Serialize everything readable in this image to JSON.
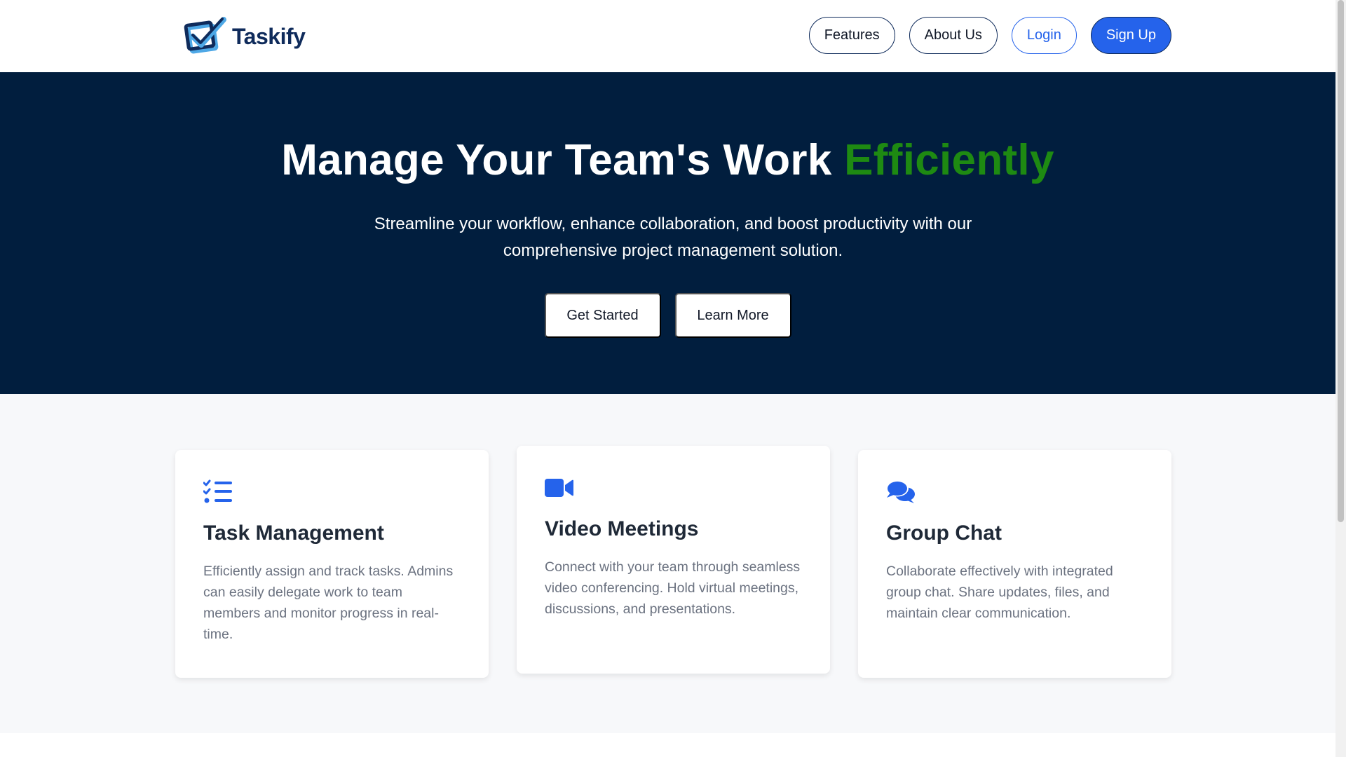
{
  "brand": {
    "name": "Taskify",
    "logo_icon": "checkbox-check-logo",
    "color_dark": "#0f2b5b",
    "color_accent": "#2563eb"
  },
  "nav": {
    "features": "Features",
    "about": "About Us",
    "login": "Login",
    "signup": "Sign Up"
  },
  "hero": {
    "title_main": "Manage Your Team's Work ",
    "title_accent": "Efficiently",
    "subtitle": "Streamline your workflow, enhance collaboration, and boost productivity with our comprehensive project management solution.",
    "get_started": "Get Started",
    "learn_more": "Learn More",
    "background_color": "#011e3e",
    "accent_color": "#1e8a12"
  },
  "features": [
    {
      "icon": "task-list-icon",
      "title": "Task Management",
      "description": "Efficiently assign and track tasks. Admins can easily delegate work to team members and monitor progress in real-time."
    },
    {
      "icon": "video-camera-icon",
      "title": "Video Meetings",
      "description": "Connect with your team through seamless video conferencing. Hold virtual meetings, discussions, and presentations."
    },
    {
      "icon": "chat-bubbles-icon",
      "title": "Group Chat",
      "description": "Collaborate effectively with integrated group chat. Share updates, files, and maintain clear communication."
    }
  ]
}
